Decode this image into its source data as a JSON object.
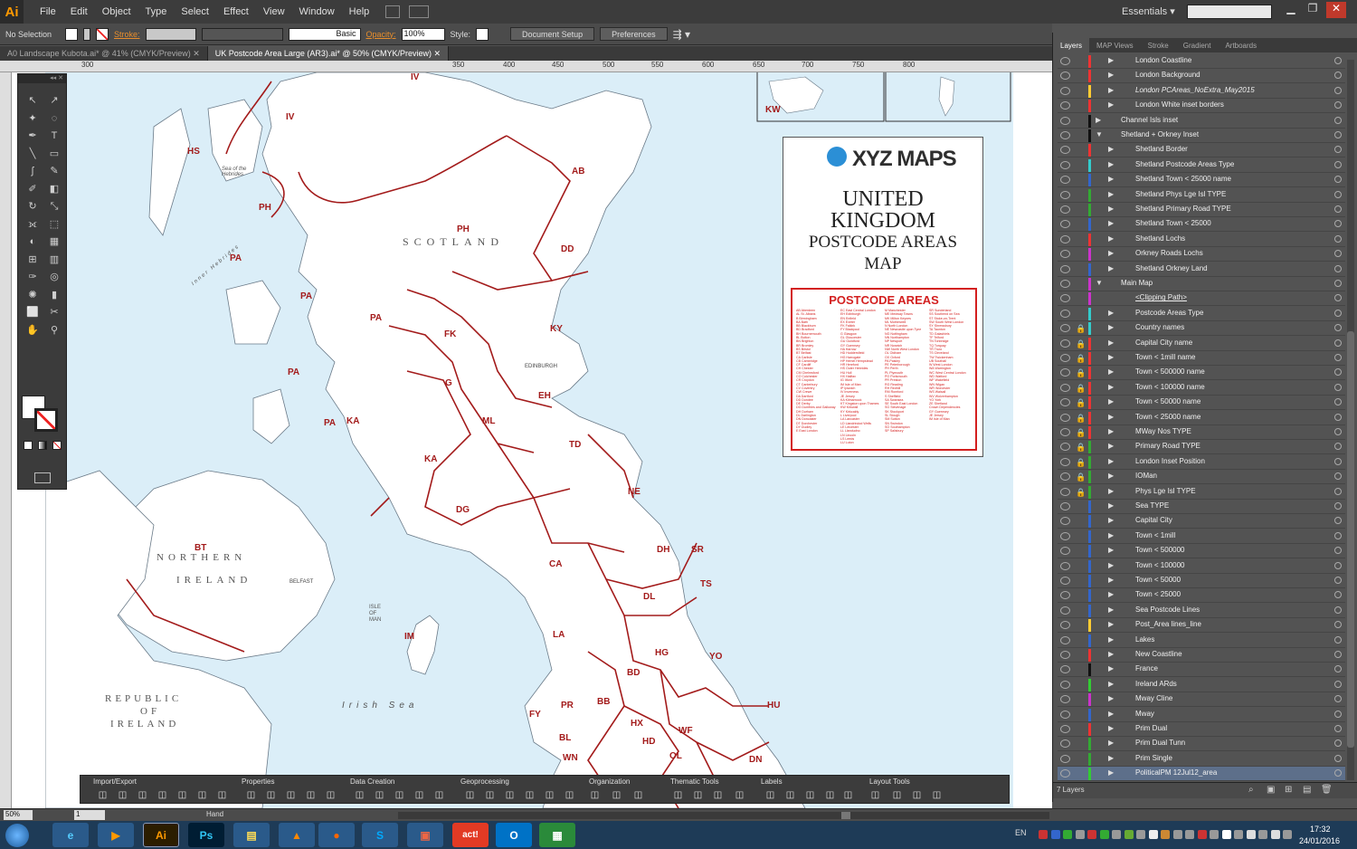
{
  "app": {
    "logo": "Ai"
  },
  "menu": [
    "File",
    "Edit",
    "Object",
    "Type",
    "Select",
    "Effect",
    "View",
    "Window",
    "Help"
  ],
  "workspace": {
    "label": "Essentials"
  },
  "control": {
    "selection": "No Selection",
    "stroke_label": "Stroke:",
    "brush": "Basic",
    "opacity_label": "Opacity:",
    "opacity_value": "100%",
    "style_label": "Style:",
    "document_setup": "Document Setup",
    "preferences": "Preferences"
  },
  "tabs": [
    {
      "label": "A0 Landscape Kubota.ai* @ 41% (CMYK/Preview)",
      "active": false
    },
    {
      "label": "UK Postcode Area Large (AR3).ai* @ 50% (CMYK/Preview)",
      "active": true
    }
  ],
  "ruler_h": [
    "300",
    "250",
    "300",
    "350",
    "400",
    "450",
    "500",
    "550",
    "600",
    "650",
    "700",
    "750",
    "800"
  ],
  "ruler_v": [
    "6",
    "6",
    "7",
    "7",
    "8",
    "8"
  ],
  "map": {
    "scotland": "SCOTLAND",
    "northern_ireland": [
      "NORTHERN",
      "IRELAND"
    ],
    "republic": [
      "REPUBLIC",
      "OF",
      "IRELAND"
    ],
    "irish_sea": "Irish Sea",
    "isle_of_man": [
      "ISLE",
      "OF",
      "MAN"
    ],
    "sea_of_hebrides": [
      "Sea of the",
      "Hebrides"
    ],
    "inner_hebrides": "Inner Hebrides",
    "edinburgh": "EDINBURGH",
    "belfast": "BELFAST",
    "kw_inset": "KW",
    "areas": [
      "IV",
      "IV",
      "HS",
      "PH",
      "PH",
      "AB",
      "DD",
      "PA",
      "PA",
      "PA",
      "PA",
      "PA",
      "KY",
      "FK",
      "EH",
      "G",
      "ML",
      "KA",
      "KA",
      "TD",
      "DG",
      "NE",
      "BT",
      "IM",
      "CA",
      "DH",
      "SR",
      "TS",
      "DL",
      "LA",
      "YO",
      "HG",
      "BD",
      "PR",
      "BB",
      "HX",
      "HU",
      "WF",
      "FY",
      "LS",
      "OL",
      "HD",
      "DN",
      "BL",
      "WN"
    ]
  },
  "legend": {
    "brand": "XYZ MAPS",
    "title": [
      "UNITED",
      "KINGDOM",
      "POSTCODE AREAS",
      "MAP"
    ],
    "box_title": "POSTCODE AREAS",
    "columns": [
      [
        "AB Aberdeen",
        "AL St. Albans",
        "B Birmingham",
        "BA Bath",
        "BB Blackburn",
        "BD Bradford",
        "BH Bournemouth",
        "BL Bolton",
        "BN Brighton",
        "BR Bromley",
        "BS Bristol",
        "BT Belfast",
        "CA Carlisle",
        "CB Cambridge",
        "CF Cardiff",
        "CH Chester",
        "CM Chelmsford",
        "CO Colchester",
        "CR Croydon",
        "CT Canterbury",
        "CV Coventry",
        "CW Crewe",
        "DA Dartford",
        "DD Dundee",
        "DE Derby",
        "DG Dumfries and Galloway",
        "DH Durham",
        "DL Darlington",
        "DN Doncaster",
        "DT Dorchester",
        "DY Dudley",
        "E East London"
      ],
      [
        "EC East Central London",
        "EH Edinburgh",
        "EN Enfield",
        "EX Exeter",
        "FK Falkirk",
        "FY Blackpool",
        "G Glasgow",
        "GL Gloucester",
        "GU Guildford",
        "GY Guernsey",
        "HA Harrow",
        "HD Huddersfield",
        "HG Harrogate",
        "HP Hemel Hempstead",
        "HR Hereford",
        "HS Outer Hebrides",
        "HU Hull",
        "HX Halifax",
        "IG Ilford",
        "IM Isle of Man",
        "IP Ipswich",
        "IV Inverness",
        "JE Jersey",
        "KA Kilmarnock",
        "KT Kingston upon Thames",
        "KW Kirkwall",
        "KY Kirkcaldy",
        "L Liverpool",
        "LA Lancaster",
        "LD Llandrindod Wells",
        "LE Leicester",
        "LL Llandudno",
        "LN Lincoln",
        "LS Leeds",
        "LU Luton"
      ],
      [
        "M Manchester",
        "ME Medway Towns",
        "MK Milton Keynes",
        "ML Motherwell",
        "N North London",
        "NE Newcastle upon Tyne",
        "NG Nottingham",
        "NN Northampton",
        "NP Newport",
        "NR Norwich",
        "NW North West London",
        "OL Oldham",
        "OX Oxford",
        "PA Paisley",
        "PE Peterborough",
        "PH Perth",
        "PL Plymouth",
        "PO Portsmouth",
        "PR Preston",
        "RG Reading",
        "RH Redhill",
        "RM Romford",
        "S Sheffield",
        "SA Swansea",
        "SE South East London",
        "SG Stevenage",
        "SK Stockport",
        "SL Slough",
        "SM Sutton",
        "SN Swindon",
        "SO Southampton",
        "SP Salisbury"
      ],
      [
        "SR Sunderland",
        "SS Southend on Sea",
        "ST Stoke-on-Trent",
        "SW South West London",
        "SY Shrewsbury",
        "TA Taunton",
        "TD Galashiels",
        "TF Telford",
        "TN Tonbridge",
        "TQ Torquay",
        "TR Truro",
        "TS Cleveland",
        "TW Twickenham",
        "UB Southall",
        "W West London",
        "WA Warrington",
        "WC West Central London",
        "WD Watford",
        "WF Wakefield",
        "WN Wigan",
        "WR Worcester",
        "WS Walsall",
        "WV Wolverhampton",
        "YO York",
        "ZE Shetland",
        "",
        "Crown Dependencies",
        "GY Guernsey",
        "JE Jersey",
        "IM Isle of Man"
      ]
    ]
  },
  "panel_tabs": [
    "Layers",
    "MAP Views",
    "Stroke",
    "Gradient",
    "Artboards"
  ],
  "layers": [
    {
      "name": "London Coastline",
      "indent": 2,
      "color": "#e33",
      "lock": false,
      "tri": "right"
    },
    {
      "name": "London Background",
      "indent": 2,
      "color": "#e33",
      "lock": false,
      "tri": "right"
    },
    {
      "name": "London PCAreas_NoExtra_May2015",
      "indent": 2,
      "color": "#fc3",
      "lock": false,
      "tri": "right",
      "italic": true
    },
    {
      "name": "London White inset borders",
      "indent": 2,
      "color": "#e33",
      "lock": false,
      "tri": "right"
    },
    {
      "name": "Channel Isls inset",
      "indent": 1,
      "color": "#111",
      "lock": false,
      "tri": "right"
    },
    {
      "name": "Shetland + Orkney Inset",
      "indent": 1,
      "color": "#111",
      "lock": false,
      "tri": "down"
    },
    {
      "name": "Shetland Border",
      "indent": 2,
      "color": "#e33",
      "lock": false,
      "tri": "right"
    },
    {
      "name": "Shetland Postcode Areas Type",
      "indent": 2,
      "color": "#3cc",
      "lock": false,
      "tri": "right"
    },
    {
      "name": "Shetland Town < 25000 name",
      "indent": 2,
      "color": "#36c",
      "lock": false,
      "tri": "right"
    },
    {
      "name": "Shetland Phys Lge Isl TYPE",
      "indent": 2,
      "color": "#3a3",
      "lock": false,
      "tri": "right"
    },
    {
      "name": "Shetland Primary Road TYPE",
      "indent": 2,
      "color": "#3a3",
      "lock": false,
      "tri": "right"
    },
    {
      "name": "Shetland Town < 25000",
      "indent": 2,
      "color": "#36c",
      "lock": false,
      "tri": "right"
    },
    {
      "name": "Shetland Lochs",
      "indent": 2,
      "color": "#e33",
      "lock": false,
      "tri": "right"
    },
    {
      "name": "Orkney Roads Lochs",
      "indent": 2,
      "color": "#c3c",
      "lock": false,
      "tri": "right"
    },
    {
      "name": "Shetland Orkney Land",
      "indent": 2,
      "color": "#36c",
      "lock": false,
      "tri": "right"
    },
    {
      "name": "Main Map",
      "indent": 1,
      "color": "#c3c",
      "lock": false,
      "tri": "down"
    },
    {
      "name": "<Clipping Path>",
      "indent": 2,
      "color": "#c3c",
      "lock": false,
      "tri": "none",
      "underline": true
    },
    {
      "name": "Postcode Areas Type",
      "indent": 2,
      "color": "#3cc",
      "lock": false,
      "tri": "right"
    },
    {
      "name": "Country names",
      "indent": 2,
      "color": "#3cc",
      "lock": true,
      "tri": "right"
    },
    {
      "name": "Capital City name",
      "indent": 2,
      "color": "#e33",
      "lock": true,
      "tri": "right"
    },
    {
      "name": "Town < 1mill name",
      "indent": 2,
      "color": "#e33",
      "lock": true,
      "tri": "right"
    },
    {
      "name": "Town < 500000 name",
      "indent": 2,
      "color": "#e33",
      "lock": true,
      "tri": "right"
    },
    {
      "name": "Town < 100000 name",
      "indent": 2,
      "color": "#e33",
      "lock": true,
      "tri": "right"
    },
    {
      "name": "Town < 50000 name",
      "indent": 2,
      "color": "#e33",
      "lock": true,
      "tri": "right"
    },
    {
      "name": "Town < 25000 name",
      "indent": 2,
      "color": "#e33",
      "lock": true,
      "tri": "right"
    },
    {
      "name": "MWay Nos TYPE",
      "indent": 2,
      "color": "#e33",
      "lock": true,
      "tri": "right"
    },
    {
      "name": "Primary Road TYPE",
      "indent": 2,
      "color": "#3a3",
      "lock": true,
      "tri": "right"
    },
    {
      "name": "London Inset Position",
      "indent": 2,
      "color": "#3a3",
      "lock": true,
      "tri": "right"
    },
    {
      "name": "IOMan",
      "indent": 2,
      "color": "#3a3",
      "lock": true,
      "tri": "right"
    },
    {
      "name": "Phys Lge Isl TYPE",
      "indent": 2,
      "color": "#3a3",
      "lock": true,
      "tri": "right"
    },
    {
      "name": "Sea TYPE",
      "indent": 2,
      "color": "#36c",
      "lock": false,
      "tri": "right"
    },
    {
      "name": "Capital City",
      "indent": 2,
      "color": "#36c",
      "lock": false,
      "tri": "right"
    },
    {
      "name": "Town < 1mill",
      "indent": 2,
      "color": "#36c",
      "lock": false,
      "tri": "right"
    },
    {
      "name": "Town < 500000",
      "indent": 2,
      "color": "#36c",
      "lock": false,
      "tri": "right"
    },
    {
      "name": "Town < 100000",
      "indent": 2,
      "color": "#36c",
      "lock": false,
      "tri": "right"
    },
    {
      "name": "Town < 50000",
      "indent": 2,
      "color": "#36c",
      "lock": false,
      "tri": "right"
    },
    {
      "name": "Town < 25000",
      "indent": 2,
      "color": "#36c",
      "lock": false,
      "tri": "right"
    },
    {
      "name": "Sea Postcode Lines",
      "indent": 2,
      "color": "#36c",
      "lock": false,
      "tri": "right"
    },
    {
      "name": "Post_Area lines_line",
      "indent": 2,
      "color": "#fc3",
      "lock": false,
      "tri": "right"
    },
    {
      "name": "Lakes",
      "indent": 2,
      "color": "#36c",
      "lock": false,
      "tri": "right"
    },
    {
      "name": "New Coastline",
      "indent": 2,
      "color": "#e33",
      "lock": false,
      "tri": "right"
    },
    {
      "name": "France",
      "indent": 2,
      "color": "#111",
      "lock": false,
      "tri": "right"
    },
    {
      "name": "Ireland ARds",
      "indent": 2,
      "color": "#3c3",
      "lock": false,
      "tri": "right"
    },
    {
      "name": "Mway Cline",
      "indent": 2,
      "color": "#c3c",
      "lock": false,
      "tri": "right"
    },
    {
      "name": "Mway",
      "indent": 2,
      "color": "#36c",
      "lock": false,
      "tri": "right"
    },
    {
      "name": "Prim Dual",
      "indent": 2,
      "color": "#e33",
      "lock": false,
      "tri": "right"
    },
    {
      "name": "Prim Dual Tunn",
      "indent": 2,
      "color": "#3a3",
      "lock": false,
      "tri": "right"
    },
    {
      "name": "Prim Single",
      "indent": 2,
      "color": "#3a3",
      "lock": false,
      "tri": "right"
    },
    {
      "name": "PoliticalPM 12Jul12_area",
      "indent": 2,
      "color": "#3c3",
      "lock": false,
      "tri": "right",
      "selected": true
    }
  ],
  "layers_count": "7 Layers",
  "toolbar_groups": [
    "Import/Export",
    "Properties",
    "Data Creation",
    "Geoprocessing",
    "Organization",
    "Thematic Tools",
    "Labels",
    "Layout Tools"
  ],
  "status": {
    "zoom": "50%",
    "page": "1",
    "tool": "Hand"
  },
  "taskbar": {
    "apps": [
      {
        "name": "Ai",
        "color": "#ff9a00",
        "bg": "#2b1d00"
      },
      {
        "name": "Ps",
        "color": "#31c5f4",
        "bg": "#001d33"
      },
      {
        "name": "act!",
        "color": "#fff",
        "bg": "#e23a24"
      },
      {
        "name": "O",
        "color": "#fff",
        "bg": "#0072c6"
      }
    ],
    "lang": "EN",
    "time": "17:32",
    "date": "24/01/2016"
  },
  "colors": {
    "accent": "#ff9a00",
    "sea": "#dbeef8",
    "border": "#a31b1b",
    "legend_red": "#d31f1f"
  }
}
